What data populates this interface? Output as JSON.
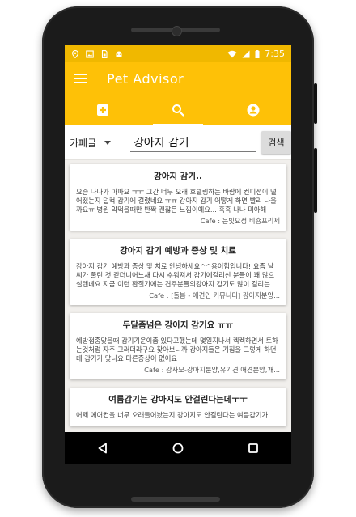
{
  "status_bar": {
    "time": "7:35",
    "left_icons": [
      "location-icon",
      "image-icon",
      "sim-card-icon",
      "android-icon"
    ],
    "right_icons": [
      "wifi-icon",
      "signal-icon",
      "battery-icon"
    ]
  },
  "app_bar": {
    "title": "Pet Advisor",
    "menu_icon": "hamburger-icon"
  },
  "tabs": [
    {
      "icon": "add-box-icon",
      "active": false
    },
    {
      "icon": "search-icon",
      "active": true
    },
    {
      "icon": "account-icon",
      "active": false
    }
  ],
  "search": {
    "category": "카페글",
    "query": "강아지 감기",
    "button_label": "검색"
  },
  "results": [
    {
      "title": "강아지 감기..",
      "body": "요즘 나나가 아파요 ㅠㅠ 그간 너무 오래 호텔링하는 바람에 컨디션이 떨어졌는지 덜컥 감기에 걸렸네요 ㅠㅠ 강아지 감기 어떻게 하면 빨리 나을까요ㅠ 병원 약먹을때만 반짝 괜찮은 느낌이에요... 흑흑 나나 미아해",
      "cafe": "Cafe : 은빛요정 비숑프리제"
    },
    {
      "title": "강아지 감기 예방과 증상 및 치료",
      "body": "강아지 감기 예방과 증상 및 치료 안녕하세요^^용이헙입니다! 요즘 날씨가 풀린 것 같더니어느새 다시 추워져서 감기에걸리신 분들이 꽤 많으실텐데요 지금 이런 환절기에는 견주분들의강아지 감기도 많이 걸리는...",
      "cafe": "Cafe : [돌봄 - 애견인 커뮤니티] 강아지분양..."
    },
    {
      "title": "두달좀넘은 강아지 감기요 ㅠㅠ",
      "body": "예방접종맞을때 감기기운이좀 있다고했는데 몇일지나서 켁켁하면서 토하는것처럼 자주 그러더라구요 찾아보니까 강아지들은 기침을 그렇게 하던데 감기가 맞나요 다른증상이 없어요",
      "cafe": "Cafe : 강사모-강아지분양,유기견 애견분양,개..."
    },
    {
      "title": "여름감기는 강아지도 안걸린다는데ㅜㅜ",
      "body": "어제 에어컨을 너무 오래틀어놨는지 강아지도 안걸린다는 여름감기가",
      "cafe": ""
    }
  ],
  "nav_bar": {
    "icons": [
      "back-icon",
      "home-icon",
      "recents-icon"
    ]
  },
  "colors": {
    "app_bar": "#fec107",
    "status_bar": "#f0b800",
    "background": "#f1efec"
  }
}
